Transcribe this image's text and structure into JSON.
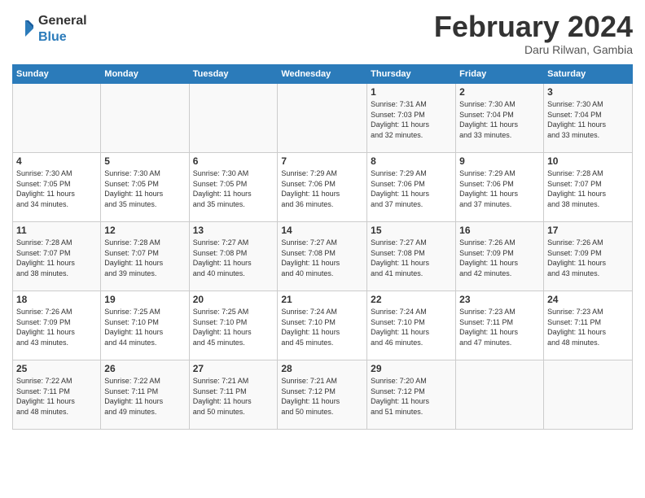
{
  "header": {
    "logo": {
      "general": "General",
      "blue": "Blue"
    },
    "title": "February 2024",
    "subtitle": "Daru Rilwan, Gambia"
  },
  "weekdays": [
    "Sunday",
    "Monday",
    "Tuesday",
    "Wednesday",
    "Thursday",
    "Friday",
    "Saturday"
  ],
  "weeks": [
    [
      {
        "day": "",
        "info": ""
      },
      {
        "day": "",
        "info": ""
      },
      {
        "day": "",
        "info": ""
      },
      {
        "day": "",
        "info": ""
      },
      {
        "day": "1",
        "info": "Sunrise: 7:31 AM\nSunset: 7:03 PM\nDaylight: 11 hours\nand 32 minutes."
      },
      {
        "day": "2",
        "info": "Sunrise: 7:30 AM\nSunset: 7:04 PM\nDaylight: 11 hours\nand 33 minutes."
      },
      {
        "day": "3",
        "info": "Sunrise: 7:30 AM\nSunset: 7:04 PM\nDaylight: 11 hours\nand 33 minutes."
      }
    ],
    [
      {
        "day": "4",
        "info": "Sunrise: 7:30 AM\nSunset: 7:05 PM\nDaylight: 11 hours\nand 34 minutes."
      },
      {
        "day": "5",
        "info": "Sunrise: 7:30 AM\nSunset: 7:05 PM\nDaylight: 11 hours\nand 35 minutes."
      },
      {
        "day": "6",
        "info": "Sunrise: 7:30 AM\nSunset: 7:05 PM\nDaylight: 11 hours\nand 35 minutes."
      },
      {
        "day": "7",
        "info": "Sunrise: 7:29 AM\nSunset: 7:06 PM\nDaylight: 11 hours\nand 36 minutes."
      },
      {
        "day": "8",
        "info": "Sunrise: 7:29 AM\nSunset: 7:06 PM\nDaylight: 11 hours\nand 37 minutes."
      },
      {
        "day": "9",
        "info": "Sunrise: 7:29 AM\nSunset: 7:06 PM\nDaylight: 11 hours\nand 37 minutes."
      },
      {
        "day": "10",
        "info": "Sunrise: 7:28 AM\nSunset: 7:07 PM\nDaylight: 11 hours\nand 38 minutes."
      }
    ],
    [
      {
        "day": "11",
        "info": "Sunrise: 7:28 AM\nSunset: 7:07 PM\nDaylight: 11 hours\nand 38 minutes."
      },
      {
        "day": "12",
        "info": "Sunrise: 7:28 AM\nSunset: 7:07 PM\nDaylight: 11 hours\nand 39 minutes."
      },
      {
        "day": "13",
        "info": "Sunrise: 7:27 AM\nSunset: 7:08 PM\nDaylight: 11 hours\nand 40 minutes."
      },
      {
        "day": "14",
        "info": "Sunrise: 7:27 AM\nSunset: 7:08 PM\nDaylight: 11 hours\nand 40 minutes."
      },
      {
        "day": "15",
        "info": "Sunrise: 7:27 AM\nSunset: 7:08 PM\nDaylight: 11 hours\nand 41 minutes."
      },
      {
        "day": "16",
        "info": "Sunrise: 7:26 AM\nSunset: 7:09 PM\nDaylight: 11 hours\nand 42 minutes."
      },
      {
        "day": "17",
        "info": "Sunrise: 7:26 AM\nSunset: 7:09 PM\nDaylight: 11 hours\nand 43 minutes."
      }
    ],
    [
      {
        "day": "18",
        "info": "Sunrise: 7:26 AM\nSunset: 7:09 PM\nDaylight: 11 hours\nand 43 minutes."
      },
      {
        "day": "19",
        "info": "Sunrise: 7:25 AM\nSunset: 7:10 PM\nDaylight: 11 hours\nand 44 minutes."
      },
      {
        "day": "20",
        "info": "Sunrise: 7:25 AM\nSunset: 7:10 PM\nDaylight: 11 hours\nand 45 minutes."
      },
      {
        "day": "21",
        "info": "Sunrise: 7:24 AM\nSunset: 7:10 PM\nDaylight: 11 hours\nand 45 minutes."
      },
      {
        "day": "22",
        "info": "Sunrise: 7:24 AM\nSunset: 7:10 PM\nDaylight: 11 hours\nand 46 minutes."
      },
      {
        "day": "23",
        "info": "Sunrise: 7:23 AM\nSunset: 7:11 PM\nDaylight: 11 hours\nand 47 minutes."
      },
      {
        "day": "24",
        "info": "Sunrise: 7:23 AM\nSunset: 7:11 PM\nDaylight: 11 hours\nand 48 minutes."
      }
    ],
    [
      {
        "day": "25",
        "info": "Sunrise: 7:22 AM\nSunset: 7:11 PM\nDaylight: 11 hours\nand 48 minutes."
      },
      {
        "day": "26",
        "info": "Sunrise: 7:22 AM\nSunset: 7:11 PM\nDaylight: 11 hours\nand 49 minutes."
      },
      {
        "day": "27",
        "info": "Sunrise: 7:21 AM\nSunset: 7:11 PM\nDaylight: 11 hours\nand 50 minutes."
      },
      {
        "day": "28",
        "info": "Sunrise: 7:21 AM\nSunset: 7:12 PM\nDaylight: 11 hours\nand 50 minutes."
      },
      {
        "day": "29",
        "info": "Sunrise: 7:20 AM\nSunset: 7:12 PM\nDaylight: 11 hours\nand 51 minutes."
      },
      {
        "day": "",
        "info": ""
      },
      {
        "day": "",
        "info": ""
      }
    ]
  ]
}
